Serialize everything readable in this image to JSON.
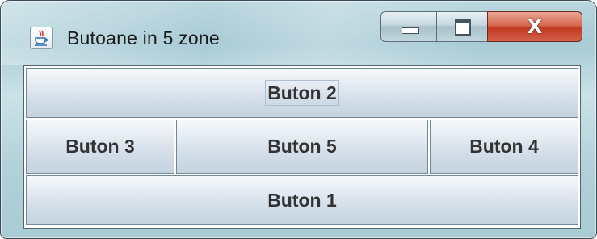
{
  "window": {
    "title": "Butoane in 5 zone",
    "icon": "java-cup-icon"
  },
  "caption_buttons": {
    "minimize_icon": "minimize-icon",
    "maximize_icon": "maximize-icon",
    "close_glyph": "X"
  },
  "buttons": {
    "north": "Buton 2",
    "west": "Buton 3",
    "center": "Buton 5",
    "east": "Buton 4",
    "south": "Buton 1"
  },
  "colors": {
    "close_button": "#c9422a",
    "button_text": "#333333"
  }
}
